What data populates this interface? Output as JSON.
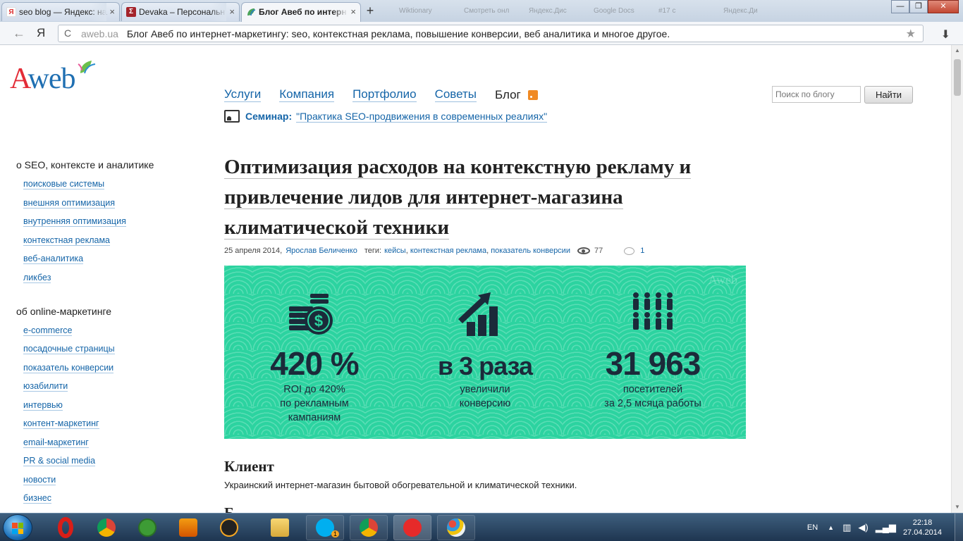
{
  "browser": {
    "tabs": [
      {
        "title": "seo blog — Яндекс: на",
        "favicon_letter": "Я",
        "favicon_color": "#d33"
      },
      {
        "title": "Devaka – Персональн",
        "favicon_letter": "Σ",
        "favicon_color": "#a4232a"
      },
      {
        "title": "Блог Авеб по интерн",
        "favicon_letter": "",
        "favicon_color": "#4aa35a",
        "active": true
      }
    ],
    "ghost_tabs": [
      "Wiktionary",
      "Смотреть онл",
      "Яндекс.Дис",
      "Google Docs",
      "#17 с",
      "Яндекс.Ди"
    ],
    "new_tab_label": "+",
    "window_controls": {
      "minimize": "—",
      "restore": "❐",
      "close": "✕"
    },
    "address": {
      "back": "←",
      "yandex_logo": "Я",
      "refresh": "C",
      "host": "aweb.ua",
      "page_title": "Блог Авеб по интернет-маркетингу: seo, контекстная реклама, повышение конверсии, веб аналитика и многое другое.",
      "star": "★",
      "download": "⬇"
    }
  },
  "site": {
    "logo_a": "A",
    "logo_web": "web",
    "nav": {
      "services": "Услуги",
      "company": "Компания",
      "portfolio": "Портфолио",
      "tips": "Советы",
      "blog": "Блог"
    },
    "search": {
      "placeholder": "Поиск по блогу",
      "button": "Найти"
    },
    "seminar": {
      "label": "Семинар:",
      "link": "\"Практика SEO-продвижения в современных реалиях\""
    }
  },
  "sidebar": {
    "group1": {
      "heading": "о SEO, контексте и аналитике",
      "items": [
        "поисковые системы",
        "внешняя оптимизация",
        "внутренняя оптимизация",
        "контекстная реклама",
        "веб-аналитика",
        "ликбез"
      ]
    },
    "group2": {
      "heading": "об online-маркетинге",
      "items": [
        "e-commerce",
        "посадочные страницы",
        "показатель конверсии",
        "юзабилити",
        "интервью",
        "контент-маркетинг",
        "email-маркетинг",
        "PR & social media",
        "новости",
        "бизнес"
      ]
    }
  },
  "article": {
    "title_lines": [
      "Оптимизация расходов на контекстную рекламу и",
      "привлечение лидов для интернет-магазина",
      "климатической техники"
    ],
    "date": "25 апреля 2014,",
    "author": "Ярослав Беличенко",
    "tags_label": "теги:",
    "tags": [
      "кейсы",
      "контекстная реклама",
      "показатель конверсии"
    ],
    "views": "77",
    "comments": "1",
    "banner": {
      "watermark": "Aweb",
      "stats": [
        {
          "value": "420 %",
          "caption_lines": [
            "ROI  до 420%",
            "по рекламным",
            "кампаниям"
          ],
          "icon": "coins-dollar-icon"
        },
        {
          "value": "в 3 раза",
          "caption_lines": [
            "увеличили",
            "конверсию"
          ],
          "icon": "growth-chart-icon"
        },
        {
          "value": "31 963",
          "caption_lines": [
            "посетителей",
            "за 2,5 мсяца работы"
          ],
          "icon": "people-icon"
        }
      ],
      "bg_color": "#2cd3a0",
      "text_color": "#1b2a3a"
    },
    "client_heading": "Клиент",
    "client_text": "Украинский интернет-магазин бытовой обогревательной и климатической техники.",
    "next_heading_partial": "Б"
  },
  "taskbar": {
    "lang": "EN",
    "time": "22:18",
    "date": "27.04.2014",
    "skype_badge": "1"
  }
}
